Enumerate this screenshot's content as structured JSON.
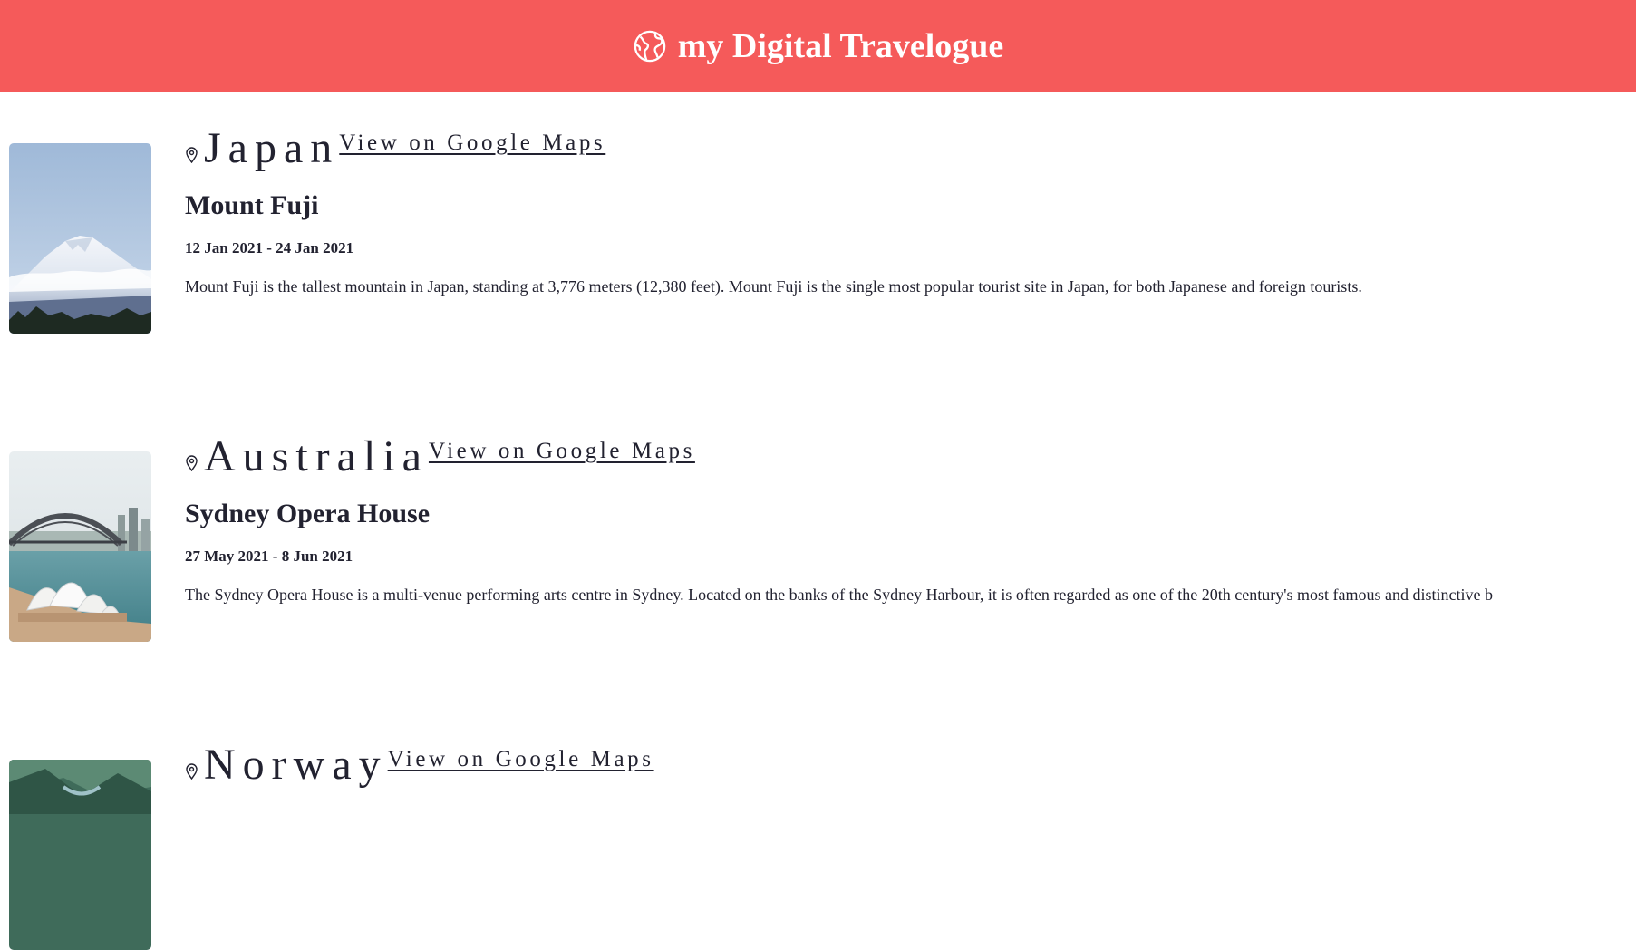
{
  "header": {
    "title": "my Digital Travelogue",
    "icon": "globe-icon",
    "background": "#f55a5a"
  },
  "entries": [
    {
      "country": "Japan",
      "maps_link": "View on Google Maps",
      "place": "Mount Fuji",
      "dates": "12 Jan 2021 - 24 Jan 2021",
      "description": "Mount Fuji is the tallest mountain in Japan, standing at 3,776 meters (12,380 feet). Mount Fuji is the single most popular tourist site in Japan, for both Japanese and foreign tourists."
    },
    {
      "country": "Australia",
      "maps_link": "View on Google Maps",
      "place": "Sydney Opera House",
      "dates": "27 May 2021 - 8 Jun 2021",
      "description": "The Sydney Opera House is a multi-venue performing arts centre in Sydney. Located on the banks of the Sydney Harbour, it is often regarded as one of the 20th century's most famous and distinctive b"
    },
    {
      "country": "Norway",
      "maps_link": "View on Google Maps"
    }
  ]
}
